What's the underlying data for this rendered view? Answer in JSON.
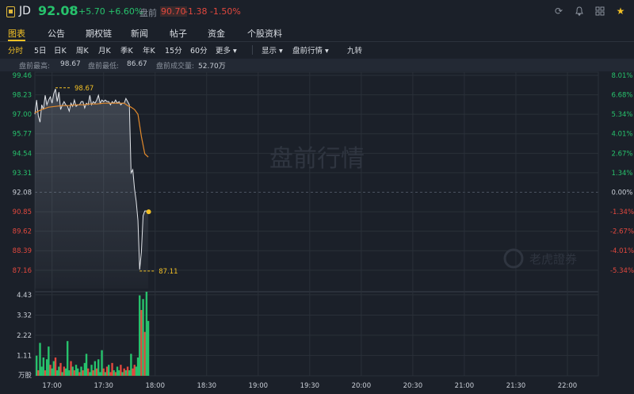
{
  "header": {
    "symbol": "JD",
    "price": "92.08",
    "arrow": "↑",
    "change": "+5.70 +6.60%",
    "premarket_label": "盘前",
    "premarket_price": "90.70",
    "premarket_change": "-1.38 -1.50%",
    "icons": [
      "refresh-icon",
      "bell-icon",
      "grid-icon",
      "star-icon"
    ],
    "colors": {
      "up": "#27c26c",
      "down": "#e2483e",
      "accent": "#f2c025"
    }
  },
  "tabs": [
    "图表",
    "公告",
    "期权链",
    "新闻",
    "帖子",
    "资金",
    "个股资料"
  ],
  "periods": {
    "items": [
      "分时",
      "5日",
      "日K",
      "周K",
      "月K",
      "季K",
      "年K",
      "15分",
      "60分",
      "更多"
    ],
    "display": "显示",
    "premarket": "盘前行情",
    "nine": "九转"
  },
  "stats": {
    "high_label": "盘前最高:",
    "high": "98.67",
    "low_label": "盘前最低:",
    "low": "86.67",
    "vol_label": "盘前成交量:",
    "vol": "52.70万"
  },
  "watermark": "盘前行情",
  "brand": "老虎證券",
  "chart_data": {
    "type": "line",
    "title": "",
    "price_axis": {
      "ylim": [
        86.0,
        99.46
      ],
      "left_ticks": [
        "99.46",
        "98.23",
        "97.00",
        "95.77",
        "94.54",
        "93.31",
        "92.08",
        "90.85",
        "89.62",
        "88.39",
        "87.16"
      ],
      "right_ticks": [
        "8.01%",
        "6.68%",
        "5.34%",
        "4.01%",
        "2.67%",
        "1.34%",
        "0.00%",
        "-1.34%",
        "-2.67%",
        "-4.01%",
        "-5.34%"
      ],
      "reference_price": 92.08
    },
    "volume_axis": {
      "ylim": [
        0,
        4.6
      ],
      "ticks": [
        "4.43",
        "3.32",
        "2.22",
        "1.11"
      ],
      "unit": "万股"
    },
    "time_ticks": [
      "17:00",
      "17:30",
      "18:00",
      "18:30",
      "19:00",
      "19:30",
      "20:00",
      "20:30",
      "21:00",
      "21:30",
      "22:00"
    ],
    "time_range_min": [
      1010,
      1338
    ],
    "annotations": [
      {
        "label": "98.67",
        "t": 1022,
        "price": 98.67
      },
      {
        "label": "87.11",
        "t": 1071,
        "price": 87.11
      }
    ],
    "series": [
      {
        "name": "price",
        "t": [
          1010,
          1011,
          1012,
          1013,
          1014,
          1015,
          1016,
          1017,
          1018,
          1019,
          1020,
          1021,
          1022,
          1023,
          1024,
          1025,
          1026,
          1027,
          1028,
          1029,
          1030,
          1031,
          1032,
          1033,
          1034,
          1035,
          1036,
          1037,
          1038,
          1039,
          1040,
          1041,
          1042,
          1043,
          1044,
          1045,
          1046,
          1047,
          1048,
          1049,
          1050,
          1051,
          1052,
          1053,
          1054,
          1055,
          1056,
          1057,
          1058,
          1059,
          1060,
          1061,
          1062,
          1063,
          1064,
          1065,
          1066,
          1067,
          1068,
          1069,
          1070,
          1071,
          1072,
          1073,
          1074,
          1075,
          1076
        ],
        "values": [
          97.0,
          97.9,
          96.9,
          96.5,
          97.6,
          97.3,
          98.2,
          97.6,
          97.9,
          98.1,
          97.7,
          98.3,
          98.6,
          97.8,
          98.4,
          97.3,
          97.6,
          97.8,
          97.6,
          97.5,
          97.2,
          97.7,
          97.5,
          97.9,
          97.5,
          97.6,
          97.6,
          97.8,
          97.8,
          97.4,
          97.7,
          97.6,
          98.2,
          97.6,
          97.8,
          97.7,
          97.9,
          98.2,
          97.7,
          97.9,
          97.8,
          97.9,
          97.8,
          97.8,
          97.6,
          97.8,
          97.7,
          97.9,
          97.7,
          97.8,
          97.6,
          97.7,
          97.7,
          98.0,
          97.8,
          97.6,
          93.3,
          93.5,
          92.3,
          91.5,
          90.3,
          87.2,
          88.3,
          90.6,
          90.9,
          90.9,
          90.85
        ]
      },
      {
        "name": "average",
        "t": [
          1010,
          1014,
          1018,
          1022,
          1026,
          1030,
          1034,
          1038,
          1042,
          1046,
          1050,
          1054,
          1058,
          1062,
          1064,
          1066,
          1068,
          1070,
          1072,
          1074,
          1076
        ],
        "values": [
          97.1,
          97.3,
          97.45,
          97.5,
          97.55,
          97.55,
          97.6,
          97.6,
          97.65,
          97.65,
          97.7,
          97.7,
          97.7,
          97.7,
          97.55,
          97.45,
          97.3,
          97.0,
          95.6,
          94.5,
          94.3
        ]
      }
    ],
    "volume": {
      "t": [
        1011,
        1012,
        1013,
        1014,
        1015,
        1016,
        1017,
        1018,
        1019,
        1020,
        1021,
        1022,
        1023,
        1024,
        1025,
        1026,
        1027,
        1028,
        1029,
        1030,
        1031,
        1032,
        1033,
        1034,
        1035,
        1036,
        1037,
        1038,
        1039,
        1040,
        1041,
        1042,
        1043,
        1044,
        1045,
        1046,
        1047,
        1048,
        1049,
        1050,
        1051,
        1052,
        1053,
        1054,
        1055,
        1056,
        1057,
        1058,
        1059,
        1060,
        1061,
        1062,
        1063,
        1064,
        1065,
        1066,
        1067,
        1068,
        1069,
        1070,
        1071,
        1072,
        1073,
        1074,
        1075,
        1076
      ],
      "values": [
        1.1,
        0.3,
        1.8,
        0.5,
        1.0,
        0.3,
        0.9,
        1.6,
        0.6,
        0.4,
        0.8,
        1.0,
        0.3,
        0.5,
        0.7,
        0.2,
        0.5,
        0.4,
        1.9,
        0.3,
        0.8,
        0.5,
        0.3,
        0.6,
        0.4,
        0.2,
        0.5,
        0.3,
        0.7,
        1.2,
        0.4,
        0.2,
        0.6,
        0.3,
        0.8,
        0.4,
        0.9,
        0.2,
        1.4,
        0.4,
        0.2,
        0.5,
        0.6,
        0.2,
        0.7,
        0.3,
        0.2,
        0.5,
        0.3,
        0.6,
        0.2,
        0.4,
        0.3,
        0.5,
        0.3,
        1.2,
        0.4,
        0.6,
        0.5,
        1.0,
        4.4,
        3.6,
        4.2,
        2.4,
        4.6,
        3.0
      ],
      "direction": [
        "up",
        "down",
        "up",
        "up",
        "up",
        "down",
        "up",
        "up",
        "down",
        "up",
        "up",
        "down",
        "up",
        "up",
        "down",
        "up",
        "down",
        "up",
        "up",
        "up",
        "down",
        "up",
        "down",
        "up",
        "up",
        "down",
        "up",
        "down",
        "up",
        "up",
        "down",
        "up",
        "up",
        "down",
        "up",
        "down",
        "up",
        "up",
        "up",
        "down",
        "up",
        "down",
        "up",
        "down",
        "down",
        "up",
        "down",
        "up",
        "up",
        "down",
        "up",
        "down",
        "up",
        "down",
        "up",
        "up",
        "down",
        "down",
        "up",
        "up",
        "up",
        "down",
        "up",
        "down",
        "up",
        "up"
      ]
    }
  }
}
